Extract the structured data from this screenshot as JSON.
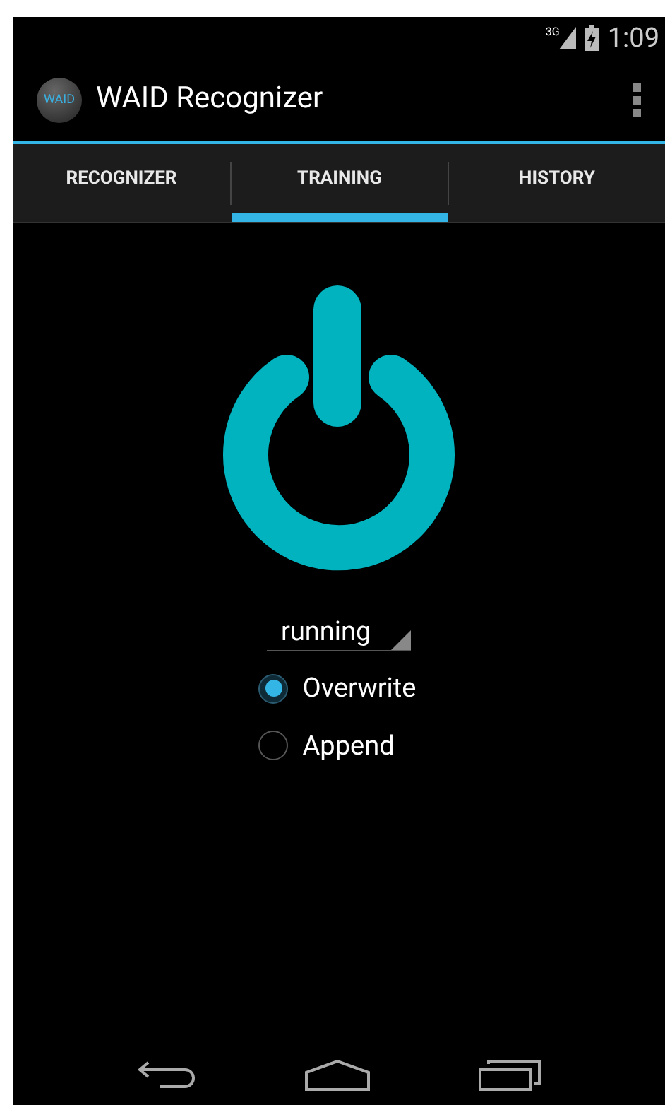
{
  "status_bar": {
    "network": "3G",
    "time": "1:09"
  },
  "app_bar": {
    "logo_text": "WAID",
    "title": "WAID Recognizer"
  },
  "tabs": [
    {
      "label": "RECOGNIZER",
      "selected": false
    },
    {
      "label": "TRAINING",
      "selected": true
    },
    {
      "label": "HISTORY",
      "selected": false
    }
  ],
  "power": {
    "on": true
  },
  "spinner": {
    "value": "running"
  },
  "radios": [
    {
      "label": "Overwrite",
      "selected": true
    },
    {
      "label": "Append",
      "selected": false
    }
  ]
}
